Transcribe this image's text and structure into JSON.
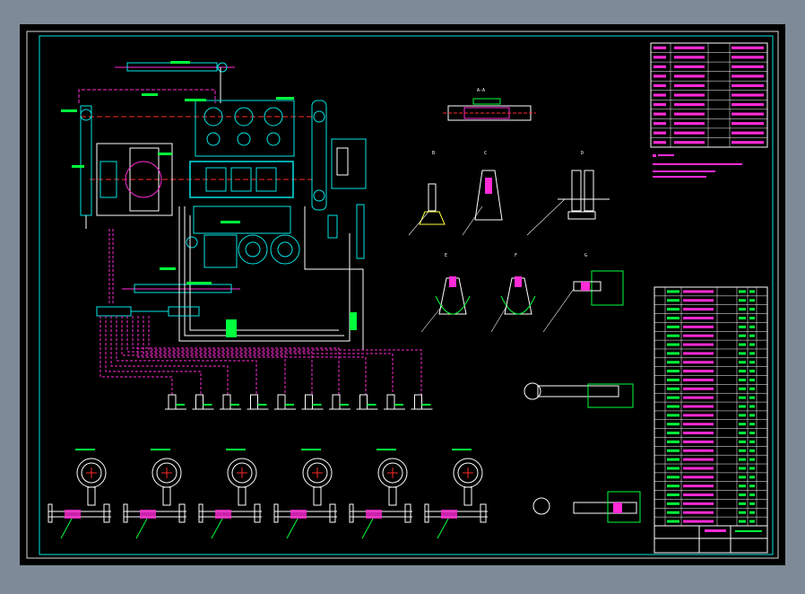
{
  "app": {
    "description_language": "none"
  },
  "colors": {
    "background_outer": "#7f8a98",
    "sheet": "#000000",
    "frame": "#d8d8d8",
    "cyan": "#00e6e6",
    "magenta": "#ff2bd6",
    "green": "#00ff3c",
    "white": "#ffffff",
    "red": "#ff2a2a",
    "yellow": "#ffff3a",
    "blue": "#3060ff"
  },
  "top_section": {
    "label_1": "A-A",
    "label_2": "B",
    "label_3": "C",
    "label_4": "D",
    "label_5": "E",
    "label_6": "F",
    "label_7": "G"
  },
  "parts_table_top": {
    "rows": 11
  },
  "parts_table_right": {
    "rows": 27
  },
  "gauges": {
    "count": 6
  },
  "instrument_row": {
    "count": 10
  },
  "title_block": {
    "text": ""
  }
}
